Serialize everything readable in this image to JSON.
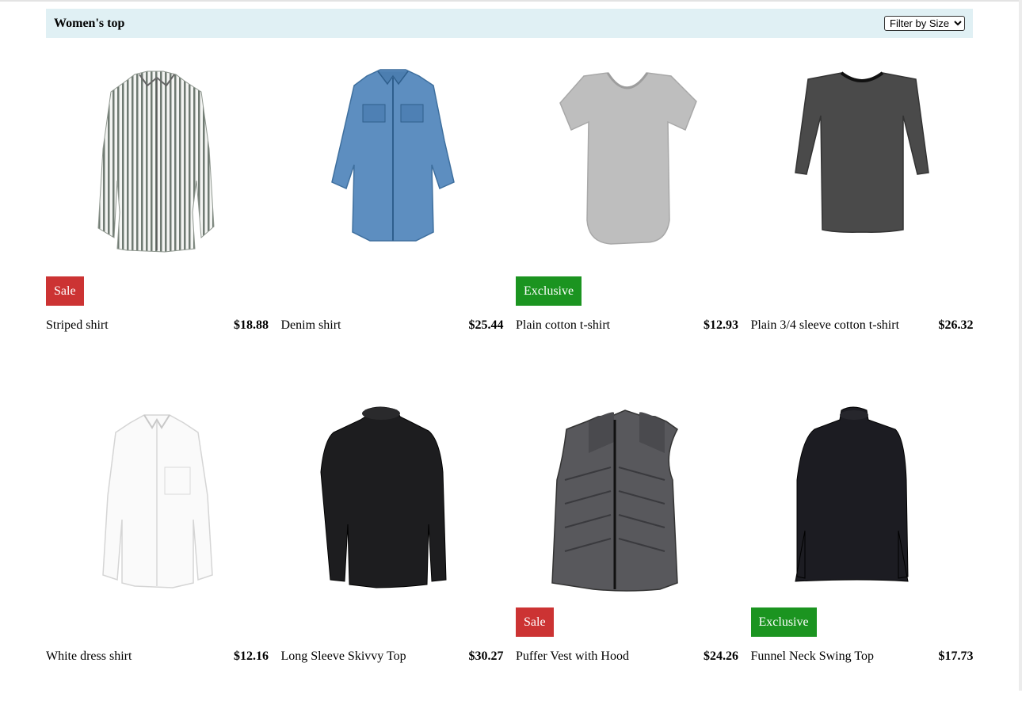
{
  "header": {
    "title": "Women's top",
    "filter_label": "Filter by Size"
  },
  "products": [
    {
      "name": "Striped shirt",
      "price": "$18.88",
      "badge": "Sale",
      "icon": "striped-shirt-image"
    },
    {
      "name": "Denim shirt",
      "price": "$25.44",
      "badge": "",
      "icon": "denim-shirt-image"
    },
    {
      "name": "Plain cotton t-shirt",
      "price": "$12.93",
      "badge": "Exclusive",
      "icon": "grey-tshirt-image"
    },
    {
      "name": "Plain 3/4 sleeve cotton t-shirt",
      "price": "$26.32",
      "badge": "",
      "icon": "charcoal-tshirt-image"
    },
    {
      "name": "White dress shirt",
      "price": "$12.16",
      "badge": "",
      "icon": "white-shirt-image"
    },
    {
      "name": "Long Sleeve Skivvy Top",
      "price": "$30.27",
      "badge": "",
      "icon": "black-skivvy-image"
    },
    {
      "name": "Puffer Vest with Hood",
      "price": "$24.26",
      "badge": "Sale",
      "icon": "puffer-vest-image"
    },
    {
      "name": "Funnel Neck Swing Top",
      "price": "$17.73",
      "badge": "Exclusive",
      "icon": "swing-top-image"
    }
  ],
  "colors": {
    "header_bg": "#e0f0f4",
    "sale": "#cc3333",
    "exclusive": "#1b9420"
  }
}
